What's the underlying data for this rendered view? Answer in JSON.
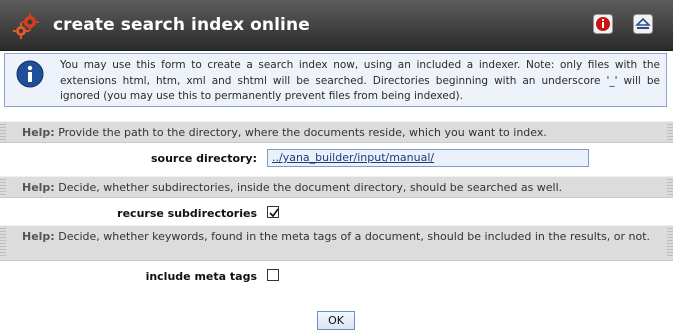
{
  "header": {
    "title": "create search index online",
    "logo_icon": "gears-icon",
    "info_icon": "info-icon",
    "collapse_icon": "collapse-icon"
  },
  "info": {
    "text": "You may use this form to create a search index now, using an included a indexer. Note: only files with the extensions html, htm, xml and shtml will be searched. Directories beginning with an underscore '_' will be ignored (you may use this to permanently prevent files from being indexed)."
  },
  "help_label": "Help:",
  "fields": [
    {
      "help": "Provide the path to the directory, where the documents reside, which you want to index.",
      "label": "source directory:",
      "value": "../yana_builder/input/manual/"
    },
    {
      "help": "Decide, whether subdirectories, inside the document directory, should be searched as well.",
      "label": "recurse subdirectories",
      "checked": true
    },
    {
      "help": "Decide, whether keywords, found in the meta tags of a document, should be included in the results, or not.",
      "label": "include meta tags",
      "checked": false
    }
  ],
  "submit_label": "OK",
  "colors": {
    "header": "#2b2b2b",
    "info_bg": "#eef3fb",
    "help_bg": "#dcdcdc",
    "input_bg": "#eaf1fb"
  }
}
